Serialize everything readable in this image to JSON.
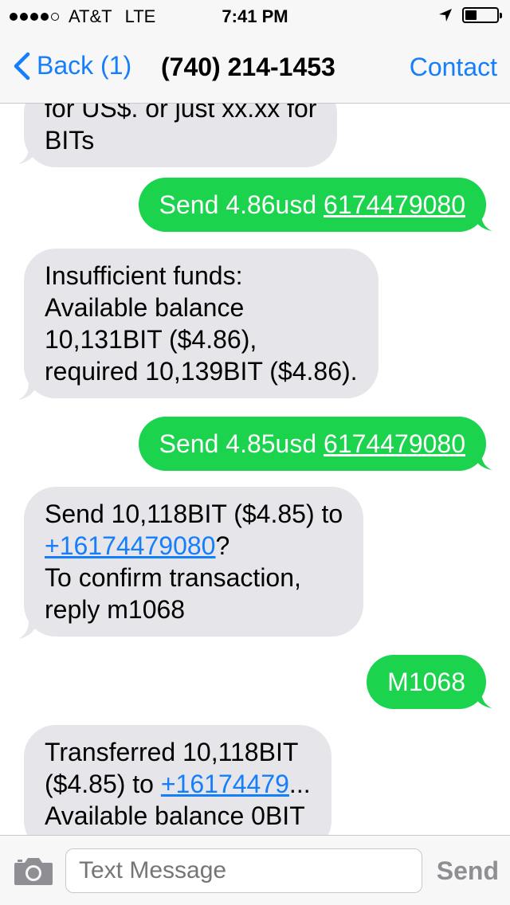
{
  "status_bar": {
    "carrier": "AT&T",
    "network": "LTE",
    "time": "7:41 PM"
  },
  "nav": {
    "back_label": "Back (1)",
    "title": "(740) 214-1453",
    "contact_label": "Contact"
  },
  "messages": {
    "m0": {
      "line1": "for US$. or just xx.xx for",
      "line2": "BITs"
    },
    "m1": {
      "text": "Send 4.86usd ",
      "link": "6174479080"
    },
    "m2": {
      "line1": "Insufficient funds:",
      "line2": "Available balance",
      "line3": "10,131BIT ($4.86),",
      "line4": "required 10,139BIT ($4.86)."
    },
    "m3": {
      "text": "Send 4.85usd ",
      "link": "6174479080"
    },
    "m4": {
      "line1": "Send 10,118BIT ($4.85) to",
      "line2_link": "+16174479080",
      "line2_suffix": "?",
      "line3": "To confirm transaction,",
      "line4": "reply m1068"
    },
    "m5": {
      "text": "M1068"
    },
    "m6": {
      "line1": "Transferred 10,118BIT",
      "line2_prefix": "($4.85) to ",
      "line2_link": "+16174479",
      "line2_suffix": "...",
      "line3": "Available balance 0BIT"
    }
  },
  "input": {
    "placeholder": "Text Message",
    "send_label": "Send"
  },
  "colors": {
    "ios_blue": "#157efb",
    "sent_bubble": "#1bd34c",
    "received_bubble": "#e5e5ea"
  }
}
